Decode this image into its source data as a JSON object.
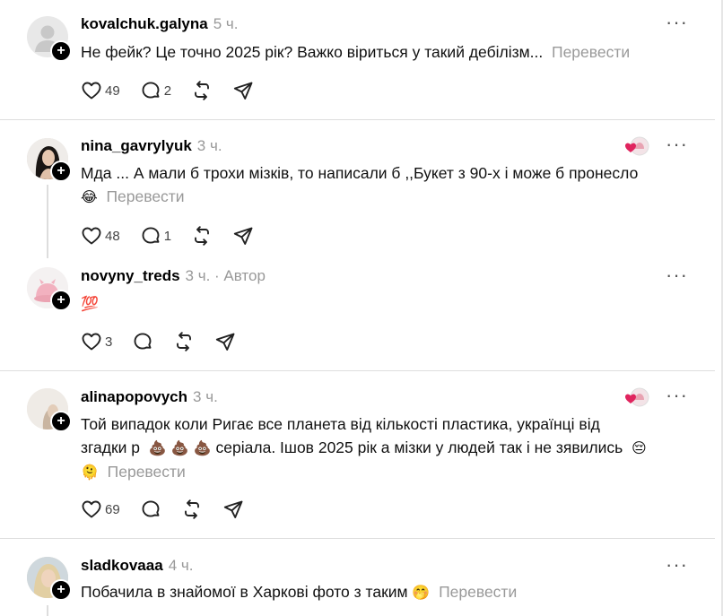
{
  "posts": [
    {
      "username": "kovalchuk.galyna",
      "time": "5 ч.",
      "text": "Не фейк? Це точно 2025 рік? Важко віриться у такий дебілізм...",
      "translate": "Перевести",
      "likes": "49",
      "replies": "2"
    },
    {
      "username": "nina_gavrylyuk",
      "time": "3 ч.",
      "text_line1": "Мда ... А мали б трохи мізків, то написали б ,,Букет з 90-х і може б пронесло",
      "emoji": "😂",
      "translate": "Перевести",
      "likes": "48",
      "replies": "1"
    },
    {
      "username": "novyny_treds",
      "time": "3 ч.",
      "author_tag": "· Автор",
      "text": "💯",
      "likes": "3"
    },
    {
      "username": "alinapopovych",
      "time": "3 ч.",
      "text_line1": "Той випадок коли Ригає все планета від кількості пластика, українці від",
      "text_line2_a": "згадки р",
      "poops": "💩 💩 💩",
      "text_line2_b": "серіала. Ішов 2025 рік а мізки у людей так і не зявились",
      "emoji_end": "😔",
      "emoji_start": "🫠",
      "translate": "Перевести",
      "likes": "69"
    },
    {
      "username": "sladkovaaa",
      "time": "4 ч.",
      "text": "Побачила в знайомої в Харкові фото з таким",
      "emoji": "🤭",
      "translate": "Перевести"
    }
  ],
  "icons": {
    "like": "heart-icon",
    "reply": "comment-icon",
    "repost": "repost-icon",
    "share": "send-icon",
    "more": "more-icon",
    "follow": "plus-icon"
  },
  "colors": {
    "text": "#111111",
    "muted": "#999999",
    "divider": "#dedede",
    "like_red": "#e0245e"
  }
}
